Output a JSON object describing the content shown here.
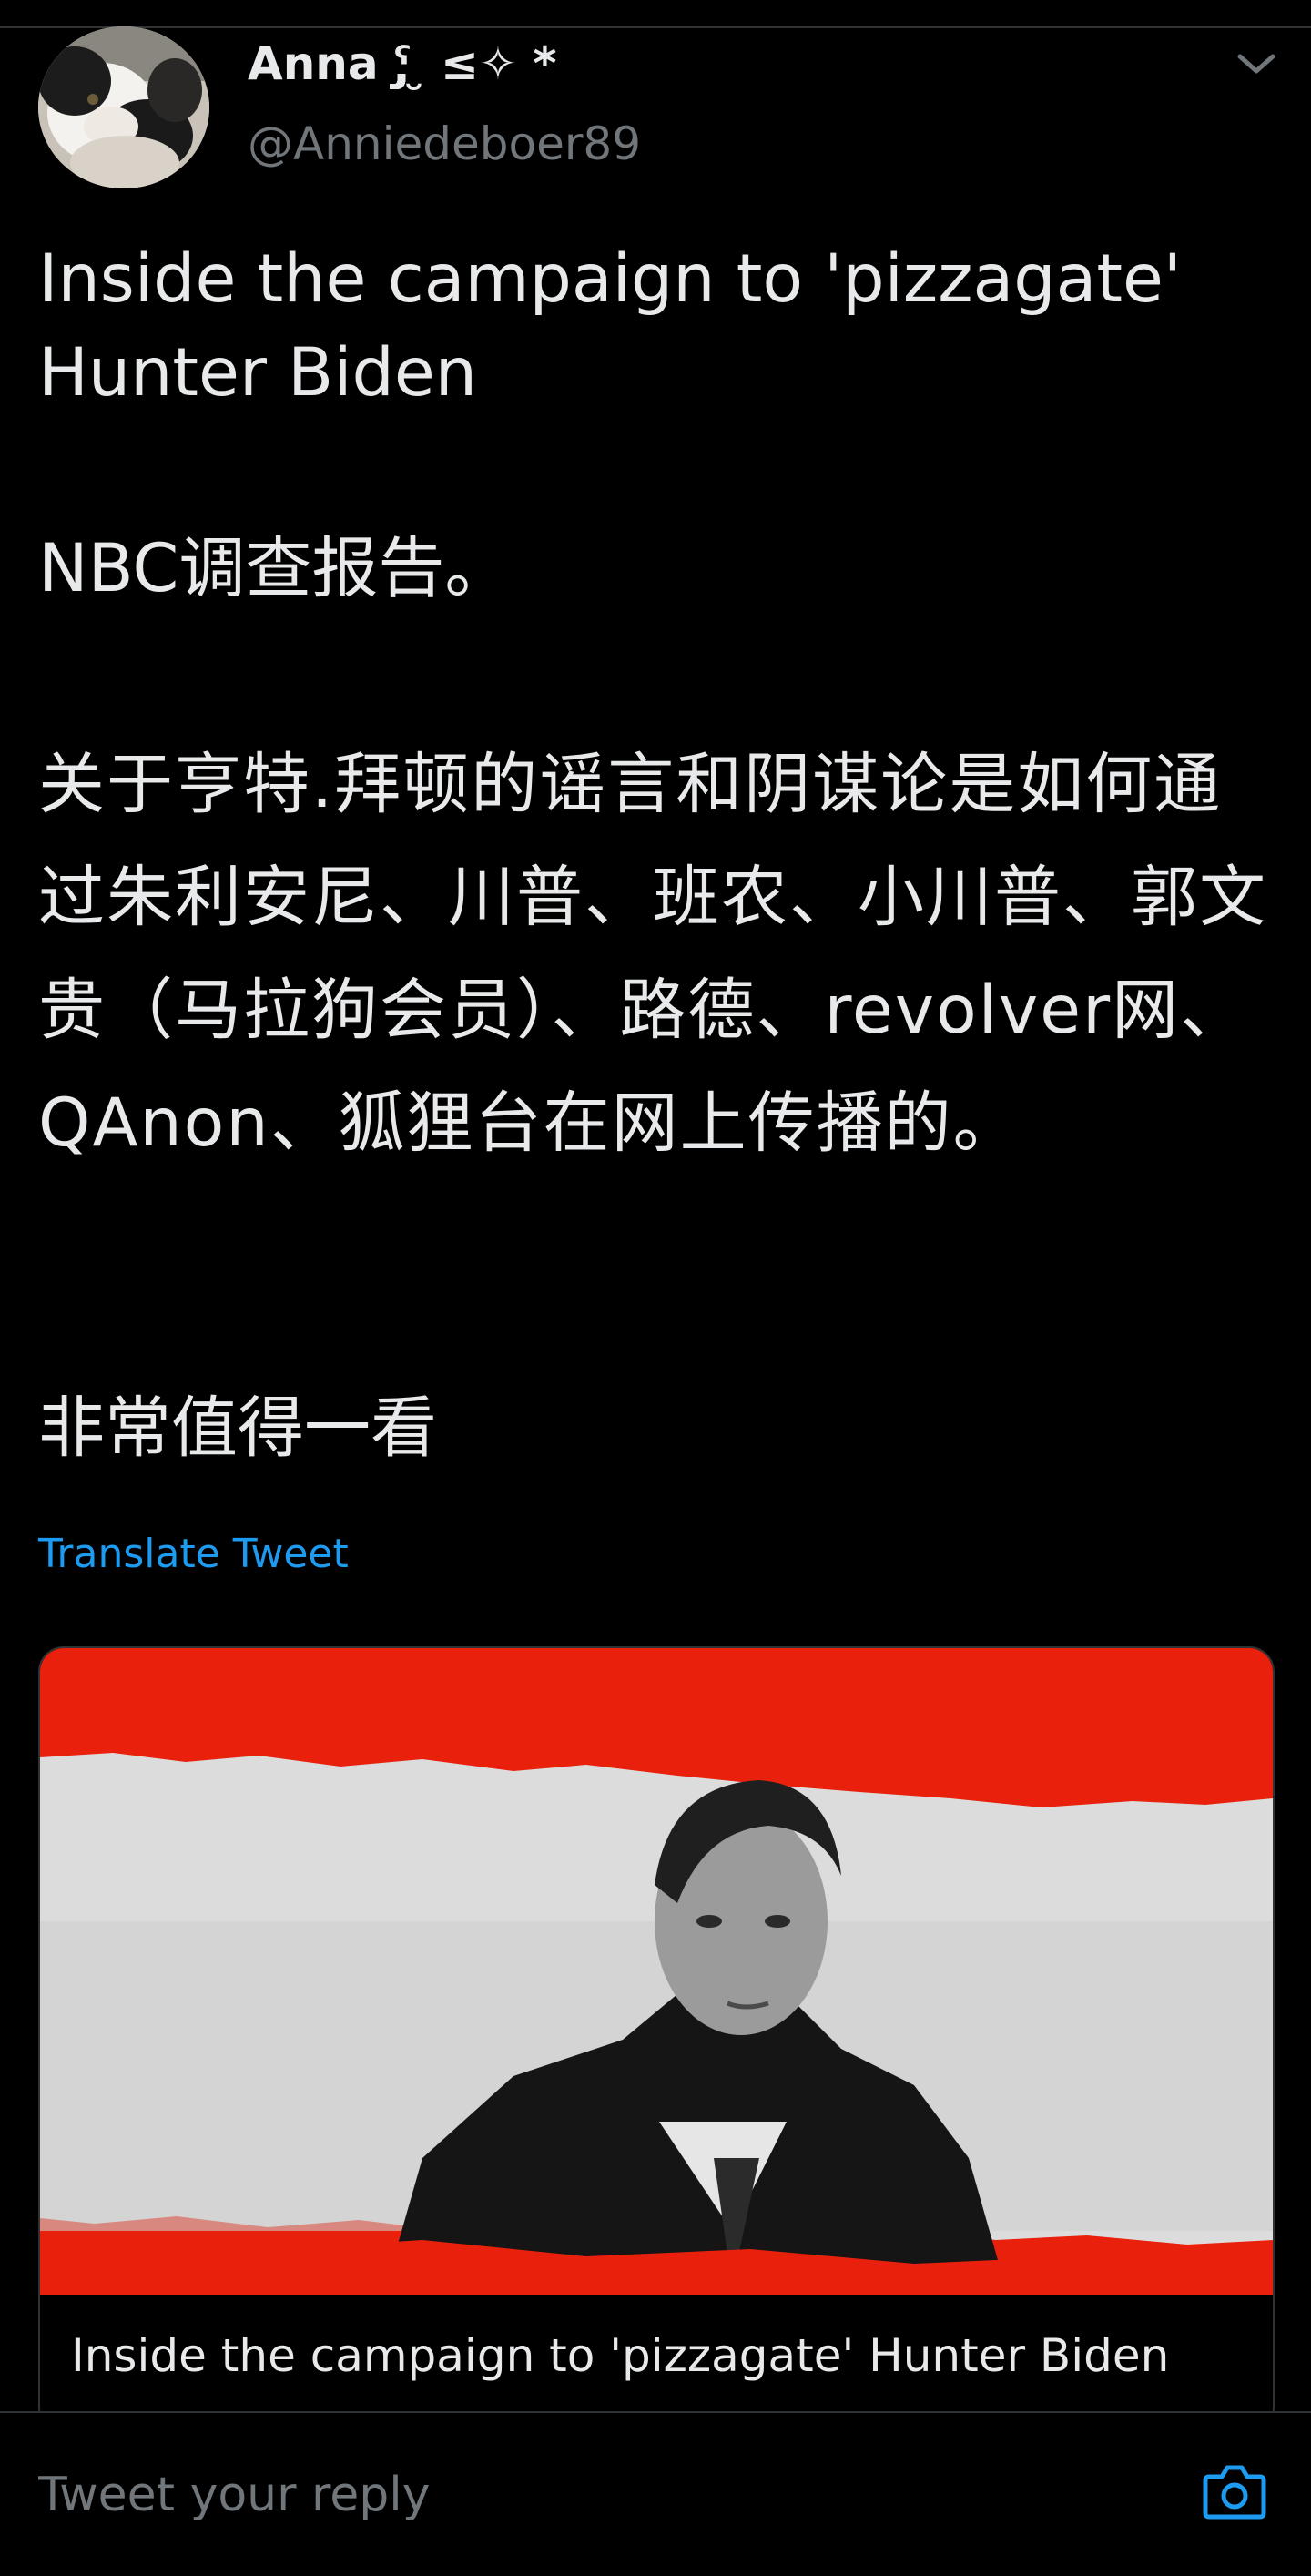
{
  "author": {
    "display_name": "Anna ˁ̡̡̡̡̡̡ ̮ ≤✧ *",
    "handle": "@Anniedeboer89"
  },
  "tweet": {
    "paragraph_1": "Inside the campaign to 'pizzagate'\nHunter Biden",
    "paragraph_2": "NBC调查报告。",
    "paragraph_3": "关于亨特.拜顿的谣言和阴谋论是如何通过朱利安尼、川普、班农、小川普、郭文贵（马拉狗会员）、路德、revolver网、QAnon、狐狸台在网上传播的。",
    "paragraph_4": "非常值得一看",
    "translate_label": "Translate Tweet"
  },
  "link_card": {
    "title": "Inside the campaign to 'pizzagate' Hunter Biden",
    "image_accent": "#e8200c"
  },
  "reply": {
    "placeholder": "Tweet your reply"
  },
  "icons": {
    "caret": "chevron-down-icon",
    "camera": "camera-icon"
  },
  "colors": {
    "background": "#000000",
    "text": "#e7e9ea",
    "muted": "#71767b",
    "link": "#1d9bf0",
    "border": "#2f3336"
  }
}
